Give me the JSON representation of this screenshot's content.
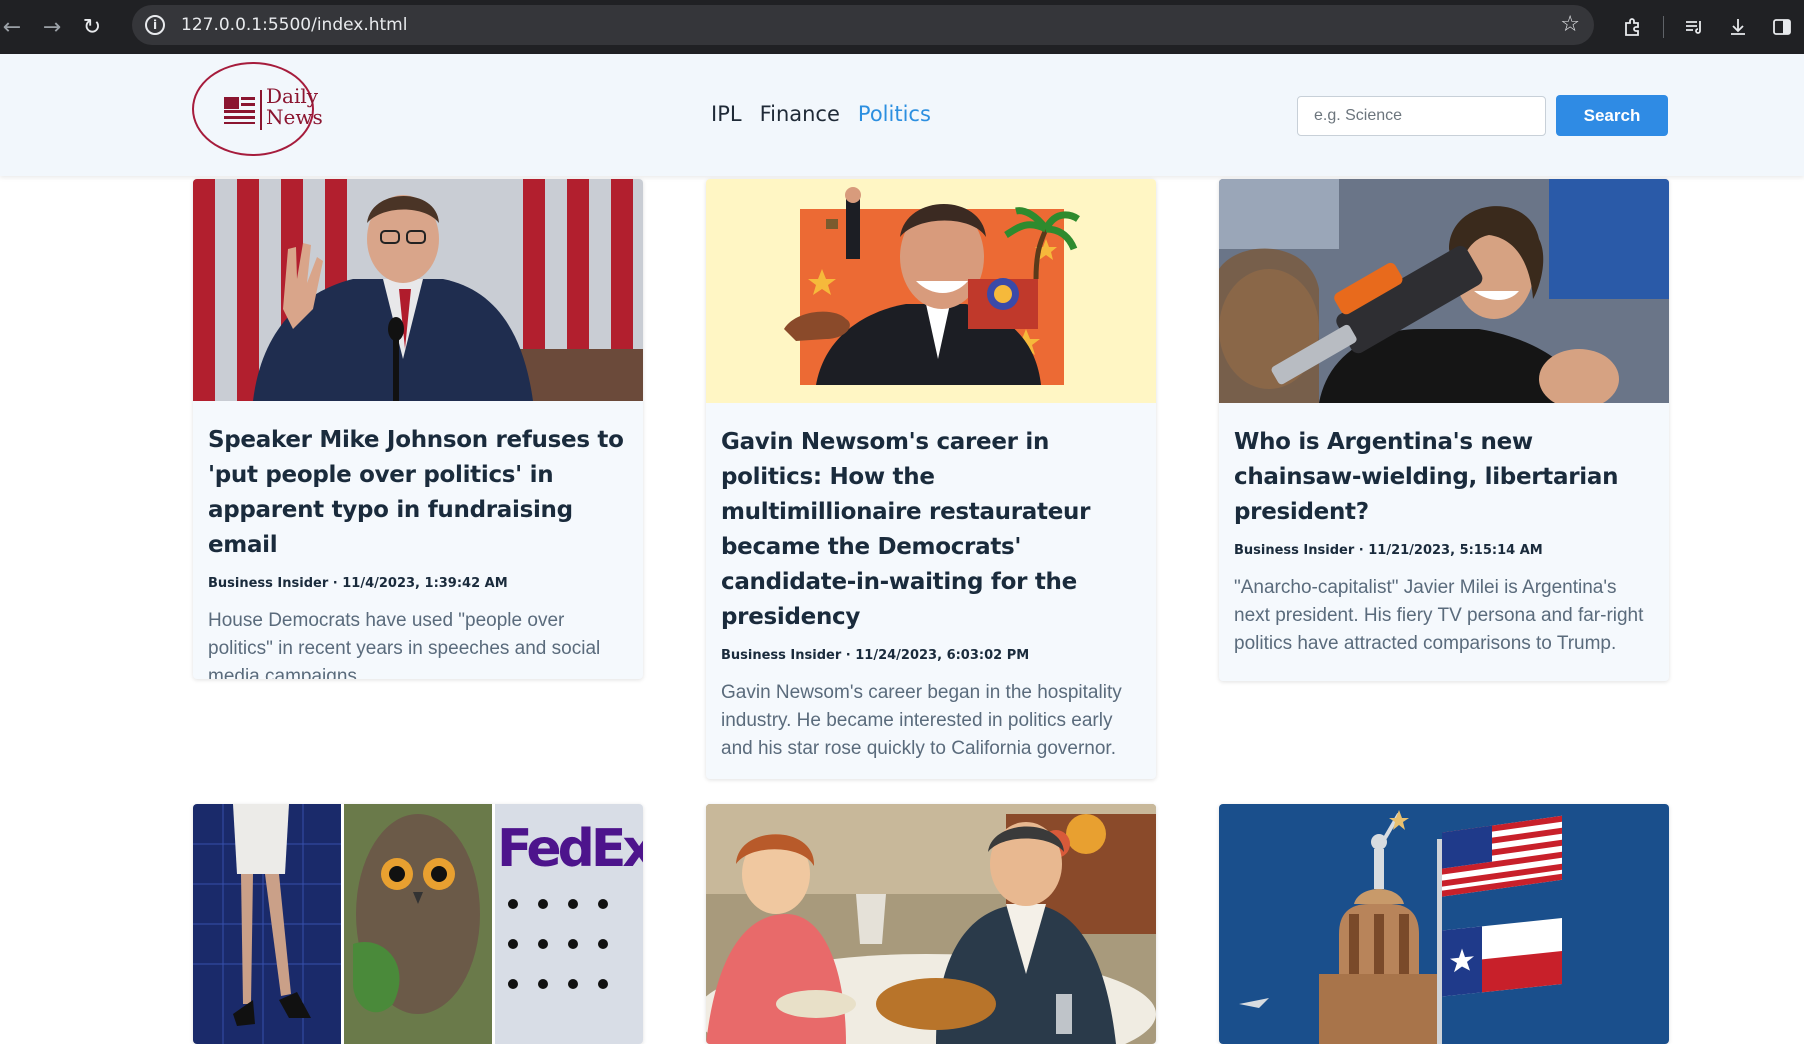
{
  "browser": {
    "url": "127.0.0.1:5500/index.html"
  },
  "site": {
    "logo_line1": "Daily",
    "logo_line2": "News",
    "nav": [
      {
        "label": "IPL",
        "active": false
      },
      {
        "label": "Finance",
        "active": false
      },
      {
        "label": "Politics",
        "active": true
      }
    ],
    "search_placeholder": "e.g. Science",
    "search_button": "Search",
    "brand_color": "#8b1530",
    "accent_color": "#2f8be4"
  },
  "articles": [
    {
      "title": "Speaker Mike Johnson refuses to 'put people over politics' in apparent typo in fundraising email",
      "meta": "Business Insider · 11/4/2023, 1:39:42 AM",
      "description": "House Democrats have used \"people over politics\" in recent years in speeches and social media campaigns."
    },
    {
      "title": "Gavin Newsom's career in politics: How the multimillionaire restaurateur became the Democrats' candidate-in-waiting for the presidency",
      "meta": "Business Insider · 11/24/2023, 6:03:02 PM",
      "description": "Gavin Newsom's career began in the hospitality industry. He became interested in politics early and his star rose quickly to California governor."
    },
    {
      "title": "Who is Argentina's new chainsaw-wielding, libertarian president?",
      "meta": "Business Insider · 11/21/2023, 5:15:14 AM",
      "description": "\"Anarcho-capitalist\" Javier Milei is Argentina's next president. His fiery TV persona and far-right politics have attracted comparisons to Trump."
    }
  ],
  "image_text": {
    "fedex": "FedEx"
  }
}
